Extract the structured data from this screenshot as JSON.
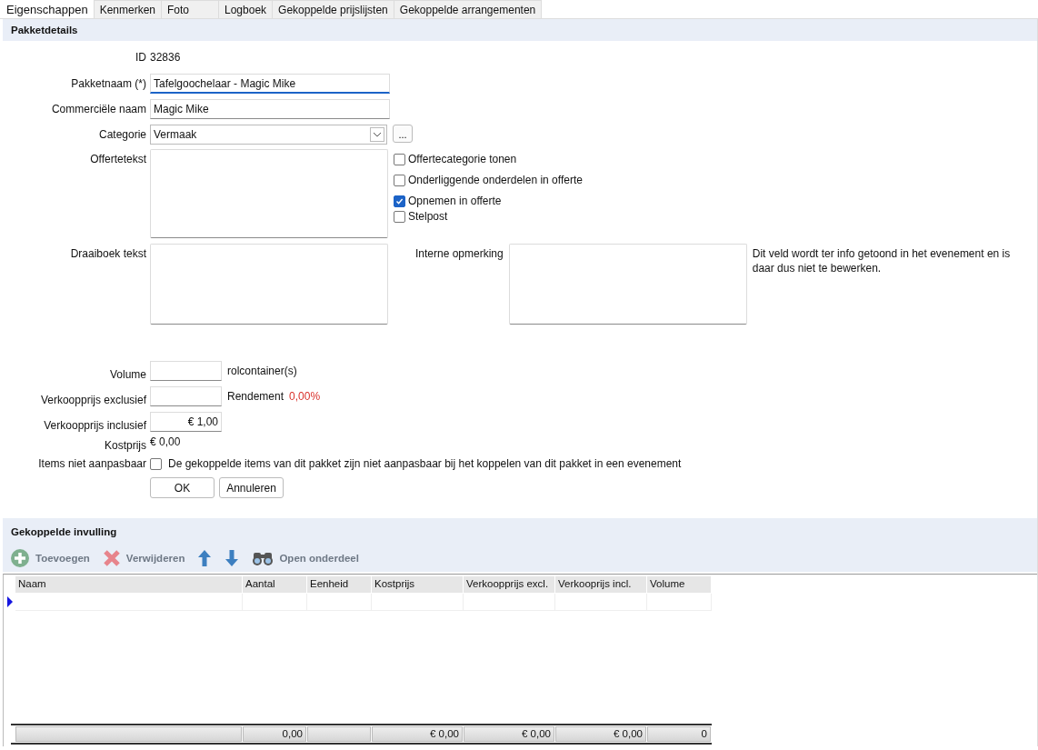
{
  "tabs": [
    {
      "label": "Eigenschappen",
      "selected": true
    },
    {
      "label": "Kenmerken",
      "selected": false
    },
    {
      "label": "Foto",
      "selected": false
    },
    {
      "label": "Logboek",
      "selected": false
    },
    {
      "label": "Gekoppelde prijslijsten",
      "selected": false
    },
    {
      "label": "Gekoppelde arrangementen",
      "selected": false
    }
  ],
  "details": {
    "title": "Pakketdetails",
    "id": {
      "label": "ID",
      "value": "32836"
    },
    "package_name": {
      "label": "Pakketnaam (*)",
      "value": "Tafelgoochelaar - Magic Mike",
      "focused": true
    },
    "commercial_name": {
      "label": "Commerciële naam",
      "value": "Magic Mike",
      "focused": false
    },
    "category": {
      "label": "Categorie",
      "value": "Vermaak",
      "button": "..."
    },
    "quote_text": {
      "label": "Offertetekst"
    },
    "quote_options": [
      {
        "label": "Offertecategorie tonen",
        "checked": false
      },
      {
        "label": "Onderliggende onderdelen in offerte",
        "checked": false
      },
      {
        "label": "Opnemen in offerte",
        "checked": true
      },
      {
        "label": "Stelpost",
        "checked": false
      }
    ],
    "script_text": {
      "label": "Draaiboek tekst"
    },
    "internal_note": {
      "label": "Interne opmerking",
      "info": "Dit veld wordt ter info getoond in het evenement en is daar dus niet te bewerken."
    },
    "volume": {
      "label": "Volume",
      "unit": "rolcontainer(s)"
    },
    "price_excl": {
      "label": "Verkoopprijs exclusief",
      "yield_label": "Rendement",
      "yield_value": "0,00%"
    },
    "price_incl": {
      "label": "Verkoopprijs inclusief",
      "value": "€ 1,00"
    },
    "cost": {
      "label": "Kostprijs",
      "value": "€ 0,00"
    },
    "items_locked": {
      "label": "Items niet aanpasbaar",
      "checked": false,
      "text": "De gekoppelde items van dit pakket zijn niet aanpasbaar bij het koppelen van dit pakket in een evenement"
    },
    "buttons": [
      "OK",
      "Annuleren"
    ]
  },
  "linked": {
    "title": "Gekoppelde invulling",
    "toolbar": [
      {
        "kind": "add",
        "label": "Toevoegen"
      },
      {
        "kind": "delete",
        "label": "Verwijderen"
      },
      {
        "kind": "up"
      },
      {
        "kind": "down"
      },
      {
        "kind": "open",
        "label": "Open onderdeel"
      }
    ],
    "columns": [
      {
        "label": "Naam"
      },
      {
        "label": "Aantal",
        "total": "0,00"
      },
      {
        "label": "Eenheid"
      },
      {
        "label": "Kostprijs",
        "total": "€ 0,00"
      },
      {
        "label": "Verkoopprijs excl.",
        "total": "€ 0,00"
      },
      {
        "label": "Verkooprijs incl.",
        "total": "€ 0,00"
      },
      {
        "label": "Volume",
        "total": "0"
      }
    ]
  }
}
